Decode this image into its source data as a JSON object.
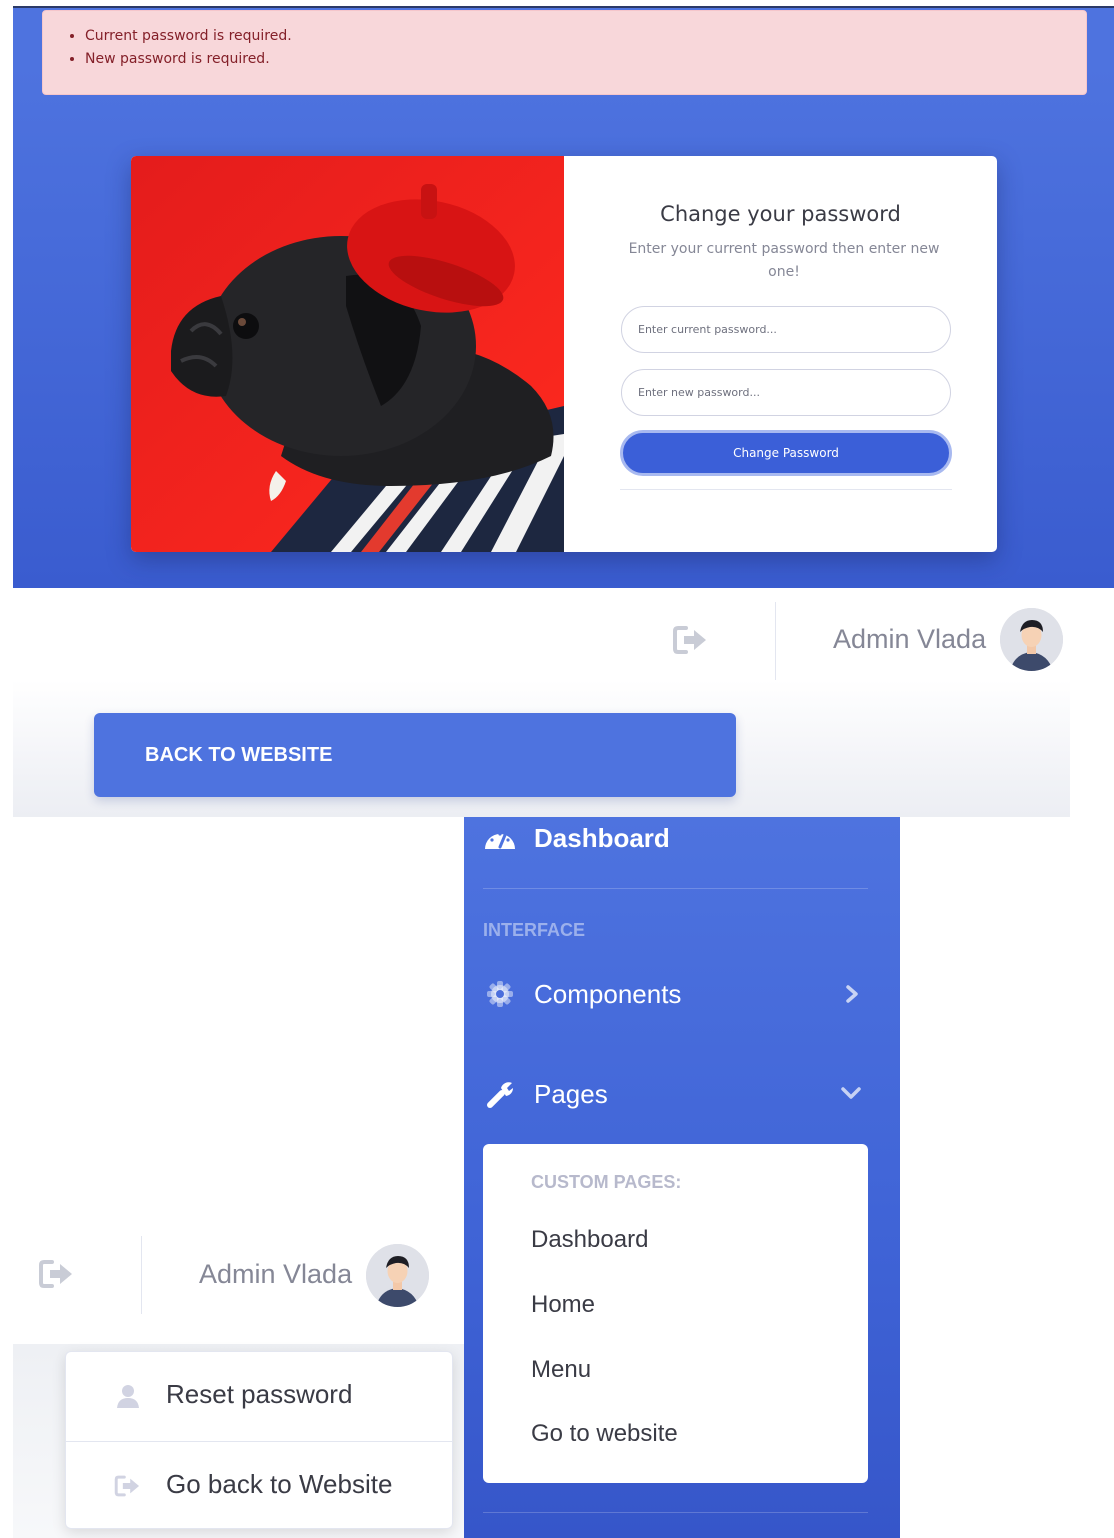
{
  "alert": {
    "errors": [
      "Current password is required.",
      "New password is required."
    ]
  },
  "change_password": {
    "title": "Change your password",
    "subtitle": "Enter your current password then enter new one!",
    "current_placeholder": "Enter current password...",
    "new_placeholder": "Enter new password...",
    "submit_label": "Change Password"
  },
  "topbar": {
    "user_name": "Admin Vlada",
    "logout_icon": "sign-out-icon"
  },
  "back_button": {
    "label": "BACK TO WEBSITE"
  },
  "sidebar": {
    "dashboard_label": "Dashboard",
    "heading_interface": "INTERFACE",
    "components_label": "Components",
    "pages_label": "Pages",
    "collapse": {
      "header": "CUSTOM PAGES:",
      "items": [
        "Dashboard",
        "Home",
        "Menu",
        "Go to website"
      ]
    }
  },
  "user_menu": {
    "user_name": "Admin Vlada",
    "items": [
      {
        "label": "Reset password",
        "icon": "user-icon"
      },
      {
        "label": "Go back to Website",
        "icon": "sign-out-icon"
      }
    ]
  },
  "colors": {
    "primary": "#4e73df",
    "alert_bg": "#f8d7da",
    "alert_text": "#842029",
    "text_gray": "#858796"
  }
}
